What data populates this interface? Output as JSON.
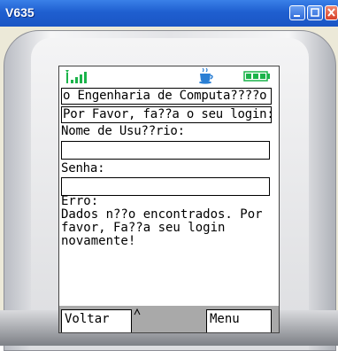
{
  "window": {
    "title": "V635"
  },
  "screen": {
    "title_line": "o Engenharia de Computa????o",
    "prompt": "Por Favor, fa??a o seu login:",
    "username_label": "Nome de Usu??rio:",
    "username_value": "",
    "password_label": "Senha:",
    "password_value": "",
    "error_message": "Erro:\nDados n??o encontrados. Por\nfavor, Fa??a seu login\nnovamente!"
  },
  "softkeys": {
    "left": "Voltar",
    "right": "Menu"
  },
  "indicators": {
    "signal": "signal-bars-icon",
    "java": "coffee-cup-icon",
    "battery": "battery-full-icon"
  },
  "colors": {
    "titlebar": "#1f5fd0",
    "signal": "#1bb34a",
    "battery": "#1bb34a",
    "coffee": "#2a7fd4"
  }
}
